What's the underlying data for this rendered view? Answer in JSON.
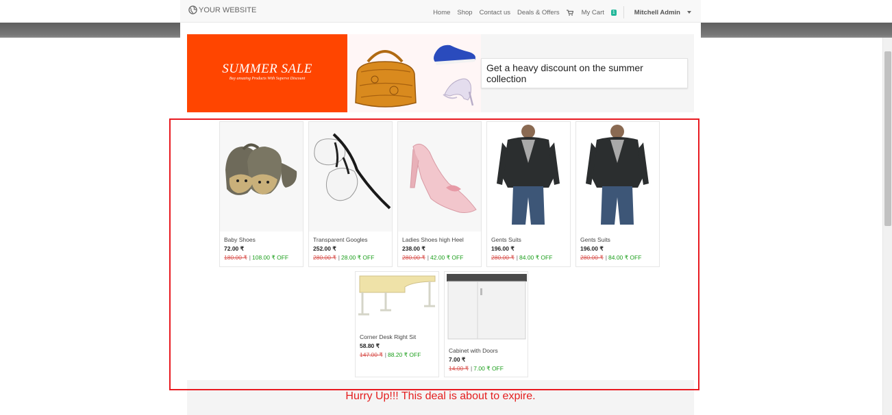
{
  "brand": {
    "name": "YOUR WEBSITE",
    "icon": "globe-icon"
  },
  "nav": {
    "home": "Home",
    "shop": "Shop",
    "contact": "Contact us",
    "deals": "Deals & Offers",
    "cart_label": "My Cart",
    "cart_count": "1",
    "user": "Mitchell Admin"
  },
  "banner": {
    "title": "SUMMER SALE",
    "subtitle": "Buy amazing Products With Superve Discount",
    "message": "Get a heavy discount on the summer collection"
  },
  "products": [
    {
      "name": "Baby Shoes",
      "price": "72.00 ₹",
      "old_price": "180.00 ₹",
      "off": "108.00 ₹ OFF"
    },
    {
      "name": "Transparent Googles",
      "price": "252.00 ₹",
      "old_price": "280.00 ₹",
      "off": "28.00 ₹ OFF"
    },
    {
      "name": "Ladies Shoes high Heel",
      "price": "238.00 ₹",
      "old_price": "280.00 ₹",
      "off": "42.00 ₹ OFF"
    },
    {
      "name": "Gents Suits",
      "price": "196.00 ₹",
      "old_price": "280.00 ₹",
      "off": "84.00 ₹ OFF"
    },
    {
      "name": "Gents Suits",
      "price": "196.00 ₹",
      "old_price": "280.00 ₹",
      "off": "84.00 ₹ OFF"
    },
    {
      "name": "Corner Desk Right Sit",
      "price": "58.80 ₹",
      "old_price": "147.00 ₹",
      "off": "88.20 ₹ OFF"
    },
    {
      "name": "Cabinet with Doors",
      "price": "7.00 ₹",
      "old_price": "14.00 ₹",
      "off": "7.00 ₹ OFF"
    }
  ],
  "separator": "|",
  "hurry": "Hurry Up!!! This deal is about to expire.",
  "colors": {
    "banner_red": "#ff4500",
    "old_price": "#d9534f",
    "off_green": "#1a9e1a",
    "hurry_red": "#e41e1e",
    "highlight_border": "#e8191f",
    "cart_badge": "#21b799"
  }
}
